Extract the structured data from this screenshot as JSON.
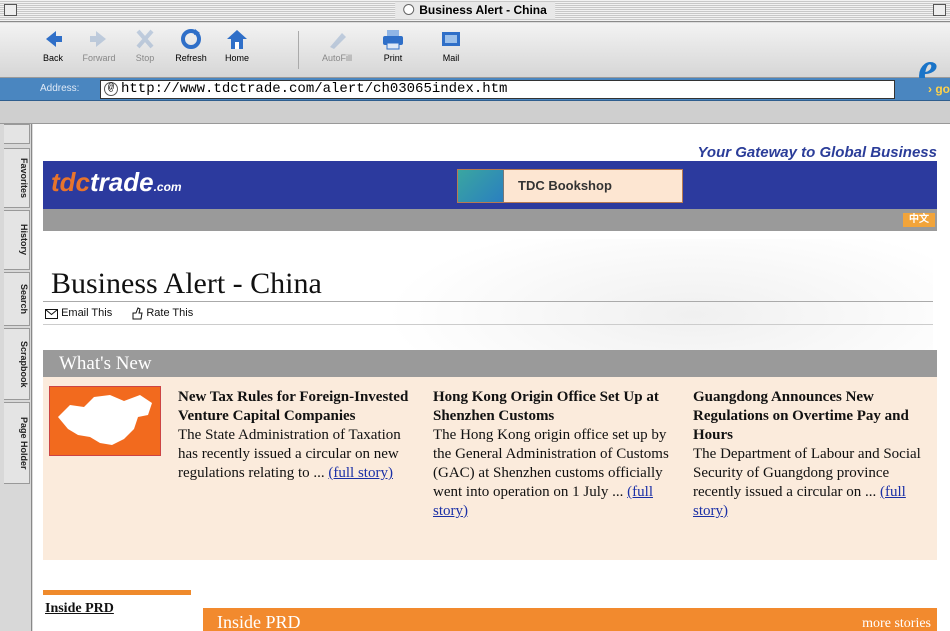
{
  "window": {
    "title": "Business Alert - China"
  },
  "toolbar": {
    "buttons": [
      {
        "label": "Back",
        "icon": "back-arrow-icon",
        "enabled": true
      },
      {
        "label": "Forward",
        "icon": "forward-arrow-icon",
        "enabled": false
      },
      {
        "label": "Stop",
        "icon": "stop-icon",
        "enabled": false
      },
      {
        "label": "Refresh",
        "icon": "refresh-icon",
        "enabled": true
      },
      {
        "label": "Home",
        "icon": "home-icon",
        "enabled": true
      },
      {
        "label": "AutoFill",
        "icon": "autofill-icon",
        "enabled": false
      },
      {
        "label": "Print",
        "icon": "print-icon",
        "enabled": true
      },
      {
        "label": "Mail",
        "icon": "mail-icon",
        "enabled": true
      }
    ]
  },
  "address": {
    "label": "Address:",
    "url": "http://www.tdctrade.com/alert/ch03065index.htm",
    "go": "go"
  },
  "sidebar": {
    "tabs": [
      "Favorites",
      "History",
      "Search",
      "Scrapbook",
      "Page Holder"
    ]
  },
  "page": {
    "gateway": "Your Gateway to Global Business",
    "logo": {
      "tdc": "tdc",
      "trade": "trade",
      "com": ".com"
    },
    "bookshop": "TDC Bookshop",
    "chinese": "中文",
    "title": "Business Alert - China",
    "email_this": "Email This",
    "rate_this": "Rate This",
    "whats_new": "What's New",
    "stories": [
      {
        "headline": "New Tax Rules for Foreign-Invested Venture Capital Companies",
        "body": "The State Administration of Taxation has recently issued a circular on new regulations relating to ...",
        "link": "(full story)"
      },
      {
        "headline": "Hong Kong Origin Office Set Up at Shenzhen Customs",
        "body": "The Hong Kong origin office set up by the General Administration of Customs (GAC) at Shenzhen customs officially went into operation on 1 July ...",
        "link": "(full story)"
      },
      {
        "headline": "Guangdong Announces New Regulations on Overtime Pay and Hours",
        "body": "The Department of Labour and Social Security of Guangdong province recently issued a circular on ...",
        "link": "(full story)"
      }
    ],
    "inside_prd_side": "Inside PRD",
    "inside_prd_main": "Inside PRD",
    "more_stories": "more stories"
  },
  "colors": {
    "accent": "#2c3a9e",
    "orange": "#f28a2e",
    "peach": "#fbebdc"
  }
}
